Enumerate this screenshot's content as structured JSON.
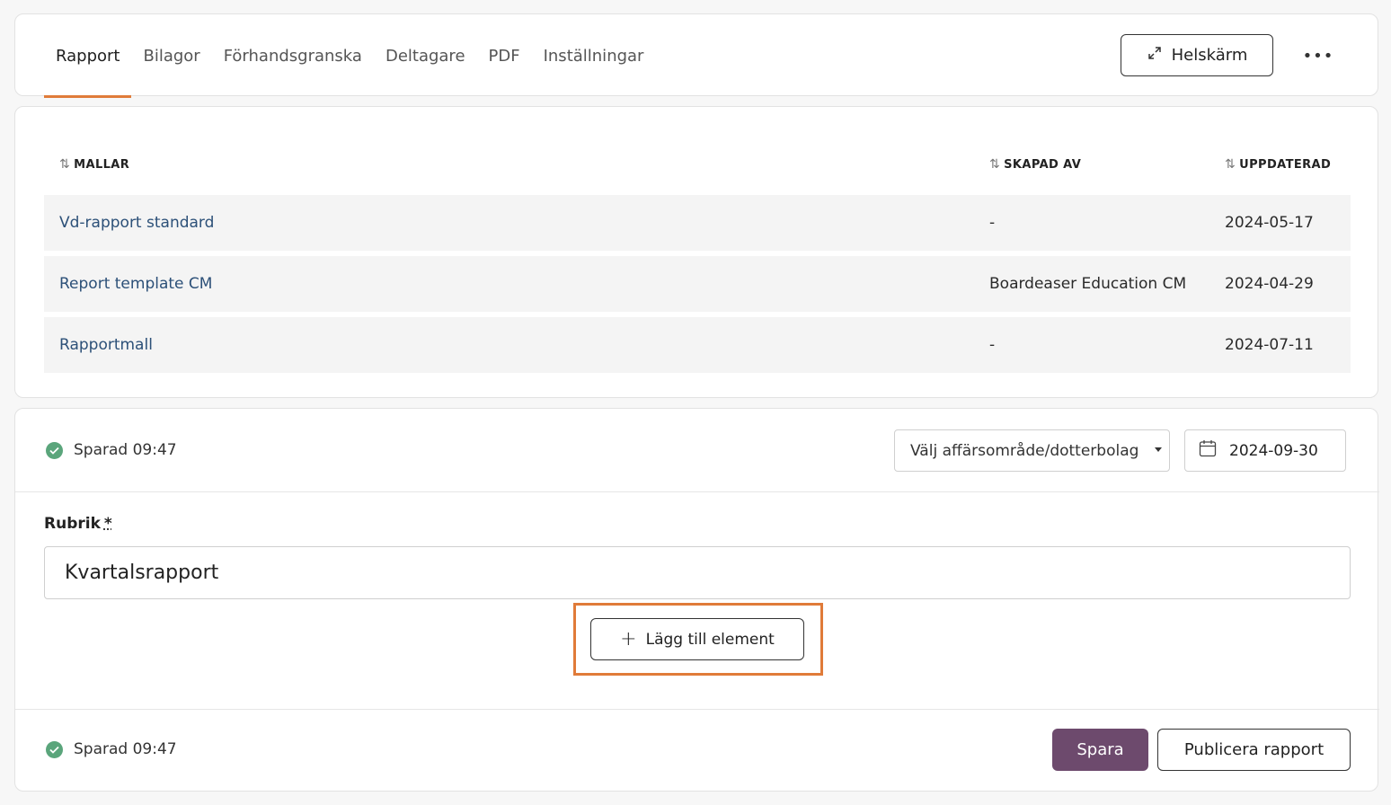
{
  "tabs": [
    {
      "label": "Rapport",
      "active": true
    },
    {
      "label": "Bilagor",
      "active": false
    },
    {
      "label": "Förhandsgranska",
      "active": false
    },
    {
      "label": "Deltagare",
      "active": false
    },
    {
      "label": "PDF",
      "active": false
    },
    {
      "label": "Inställningar",
      "active": false
    }
  ],
  "header": {
    "fullscreen_label": "Helskärm",
    "more_label": "•••"
  },
  "templates": {
    "columns": {
      "name": "MALLAR",
      "creator": "SKAPAD AV",
      "updated": "UPPDATERAD"
    },
    "rows": [
      {
        "name": "Vd-rapport standard",
        "creator": "-",
        "updated": "2024-05-17"
      },
      {
        "name": "Report template CM",
        "creator": "Boardeaser Education CM",
        "updated": "2024-04-29"
      },
      {
        "name": "Rapportmall",
        "creator": "-",
        "updated": "2024-07-11"
      }
    ]
  },
  "editor": {
    "status_top": "Sparad 09:47",
    "business_select": "Välj affärsområde/dotterbolag",
    "date": "2024-09-30",
    "title_label": "Rubrik",
    "required_mark": "*",
    "title_value": "Kvartalsrapport",
    "add_element_label": "Lägg till element",
    "status_bottom": "Sparad 09:47",
    "save_label": "Spara",
    "publish_label": "Publicera rapport"
  },
  "colors": {
    "accent": "#e07b39",
    "primary_button": "#6d4a6d",
    "link": "#2c5078",
    "success": "#5aa57b"
  }
}
